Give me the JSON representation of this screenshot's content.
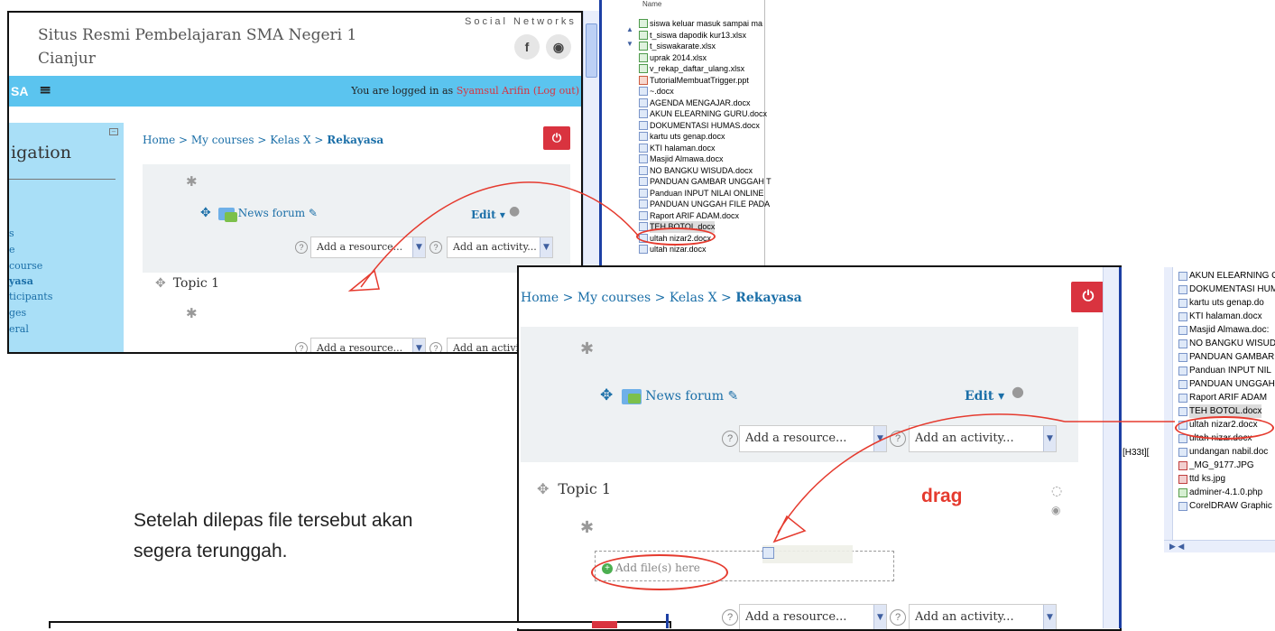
{
  "panel1": {
    "site_title_line1": "Situs Resmi Pembelajaran SMA Negeri 1",
    "site_title_line2": "Cianjur",
    "social_label": "Social Networks",
    "social_f": "f",
    "social_globe": "◉",
    "brand_partial": "SA",
    "menu_icon": "≡",
    "logged_prefix": "You are logged in as ",
    "logged_user": "Syamsul Arifin",
    "logout": "(Log out)",
    "nav_title": "igation",
    "nav_items": [
      "s",
      "e",
      "course",
      "yasa",
      "ticipants",
      "ges",
      "eral"
    ],
    "breadcrumb": {
      "home": "Home",
      "sep": " > ",
      "courses": "My courses",
      "class": "Kelas X",
      "current": "Rekayasa"
    },
    "news_forum": "News forum",
    "edit": "Edit ▾",
    "add_resource": "Add a resource...",
    "add_activity": "Add an activity...",
    "topic": "Topic 1",
    "add_resource_2": "Add a resource...",
    "add_activity_2": "Add an activi"
  },
  "filelist1": {
    "header": "Name",
    "files": [
      {
        "name": "siswa keluar masuk sampai ma",
        "type": "xl"
      },
      {
        "name": "t_siswa dapodik kur13.xlsx",
        "type": "xl"
      },
      {
        "name": "t_siswakarate.xlsx",
        "type": "xl"
      },
      {
        "name": "uprak 2014.xlsx",
        "type": "xl"
      },
      {
        "name": "v_rekap_daftar_ulang.xlsx",
        "type": "xl"
      },
      {
        "name": "TutorialMembuatTrigger.ppt",
        "type": "ppt"
      },
      {
        "name": "~.docx",
        "type": "doc"
      },
      {
        "name": "AGENDA MENGAJAR.docx",
        "type": "doc"
      },
      {
        "name": "AKUN ELEARNING GURU.docx",
        "type": "doc"
      },
      {
        "name": "DOKUMENTASI HUMAS.docx",
        "type": "doc"
      },
      {
        "name": "kartu uts genap.docx",
        "type": "doc"
      },
      {
        "name": "KTI halaman.docx",
        "type": "doc"
      },
      {
        "name": "Masjid Almawa.docx",
        "type": "doc"
      },
      {
        "name": "NO BANGKU WISUDA.docx",
        "type": "doc"
      },
      {
        "name": "PANDUAN GAMBAR UNGGAH T",
        "type": "doc"
      },
      {
        "name": "Panduan INPUT NILAI ONLINE",
        "type": "doc"
      },
      {
        "name": "PANDUAN UNGGAH FILE PADA",
        "type": "doc"
      },
      {
        "name": "Raport ARIF ADAM.docx",
        "type": "doc"
      },
      {
        "name": "TEH BOTOL.docx",
        "type": "doc"
      },
      {
        "name": "ultah nizar2.docx",
        "type": "doc"
      },
      {
        "name": "ultah nizar.docx",
        "type": "doc"
      }
    ]
  },
  "panel2": {
    "breadcrumb": {
      "home": "Home",
      "sep": " > ",
      "courses": "My courses",
      "class": "Kelas X",
      "current": "Rekayasa"
    },
    "news_forum": "News forum",
    "edit": "Edit ▾",
    "add_resource": "Add a resource...",
    "add_activity": "Add an activity...",
    "topic": "Topic 1",
    "drag": "drag",
    "add_file": "Add file(s) here",
    "add_resource_2": "Add a resource...",
    "add_activity_2": "Add an activity..."
  },
  "filelist2": {
    "side_label": "[H33t][",
    "files": [
      {
        "name": "AKUN ELEARNING G",
        "type": "doc"
      },
      {
        "name": "DOKUMENTASI HUM",
        "type": "doc"
      },
      {
        "name": "kartu uts genap.do",
        "type": "doc"
      },
      {
        "name": "KTI halaman.docx",
        "type": "doc"
      },
      {
        "name": "Masjid Almawa.doc:",
        "type": "doc"
      },
      {
        "name": "NO BANGKU WISUD",
        "type": "doc"
      },
      {
        "name": "PANDUAN GAMBAR",
        "type": "doc"
      },
      {
        "name": "Panduan INPUT NIL",
        "type": "doc"
      },
      {
        "name": "PANDUAN UNGGAH",
        "type": "doc"
      },
      {
        "name": "Raport ARIF ADAM",
        "type": "doc"
      },
      {
        "name": "TEH BOTOL.docx",
        "type": "doc"
      },
      {
        "name": "ultah nizar2.docx",
        "type": "doc"
      },
      {
        "name": "ultah nizar.docx",
        "type": "doc"
      },
      {
        "name": "undangan nabil.doc",
        "type": "doc"
      },
      {
        "name": "_MG_9177.JPG",
        "type": "jpg"
      },
      {
        "name": "ttd ks.jpg",
        "type": "jpg"
      },
      {
        "name": "adminer-4.1.0.php",
        "type": "php"
      },
      {
        "name": "CorelDRAW Graphic",
        "type": "doc"
      }
    ]
  },
  "caption": {
    "line1": "Setelah dilepas file tersebut akan",
    "line2": "segera terunggah."
  },
  "colors": {
    "accent": "#5bc4ef",
    "danger": "#d9333f",
    "link": "#1b6fa8",
    "annotation": "#e53a2e"
  }
}
